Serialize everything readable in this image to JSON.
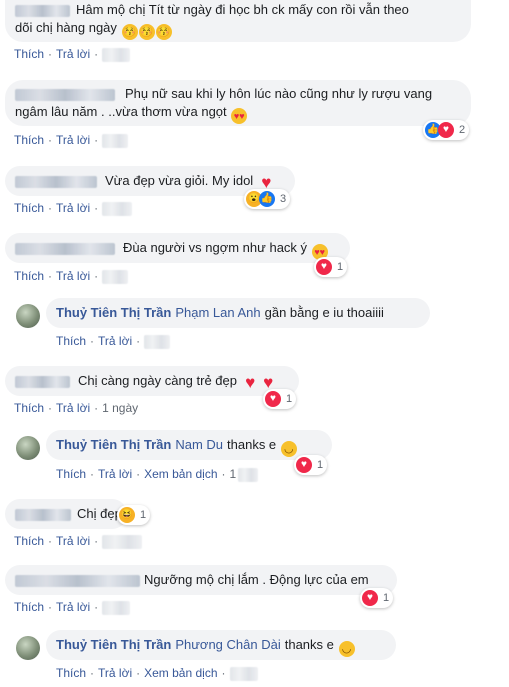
{
  "comments": [
    {
      "text": "Hâm mộ chị Tít từ ngày đi học bh ck mấy con rồi vẫn theo",
      "text2": "dõi chị hàng ngày",
      "emojis": [
        "😚",
        "😚",
        "😚"
      ],
      "like": "Thích",
      "reply": "Trả lời"
    },
    {
      "text": "Phụ nữ sau khi ly hôn lúc nào cũng như ly rượu vang",
      "text2": "ngâm lâu năm . ..vừa thơm vừa ngọt",
      "emoji": "😍",
      "like": "Thích",
      "reply": "Trả lời",
      "reaction_count": "2"
    },
    {
      "text": "Vừa đẹp vừa giỏi. My idol",
      "like": "Thích",
      "reply": "Trả lời",
      "reaction_count": "3"
    },
    {
      "text": "Đùa người vs ngợm như hack ý",
      "emoji": "😍",
      "like": "Thích",
      "reply": "Trả lời",
      "reaction_count": "1"
    },
    {
      "author": "Thuỷ Tiên Thị Trần",
      "tag": "Phạm Lan Anh",
      "text": "gần bằng e iu thoaiiii",
      "like": "Thích",
      "reply": "Trả lời"
    },
    {
      "text": "Chị càng ngày càng trẻ đẹp",
      "like": "Thích",
      "reply": "Trả lời",
      "time": "1 ngày",
      "reaction_count": "1"
    },
    {
      "author": "Thuỷ Tiên Thị Trần",
      "tag": "Nam Du",
      "text": "thanks e",
      "emoji": "😄",
      "like": "Thích",
      "reply": "Trả lời",
      "translate": "Xem bản dịch",
      "time": "1",
      "reaction_count": "1"
    },
    {
      "text": "Chị đẹp",
      "emoji": "😆",
      "like": "Thích",
      "reply": "Trả lời",
      "reaction_count": "1"
    },
    {
      "text": "Ngưỡng mộ chị lắm . Động lực của em",
      "like": "Thích",
      "reply": "Trả lời",
      "reaction_count": "1"
    },
    {
      "author": "Thuỷ Tiên Thị Trần",
      "tag": "Phương Chân Dài",
      "text": "thanks e",
      "emoji": "😊",
      "like": "Thích",
      "reply": "Trả lời",
      "translate": "Xem bản dịch"
    }
  ],
  "colors": {
    "link": "#385898",
    "bubble": "#f2f3f5",
    "meta": "#606770",
    "love": "#f0284a",
    "like": "#1877f2"
  }
}
